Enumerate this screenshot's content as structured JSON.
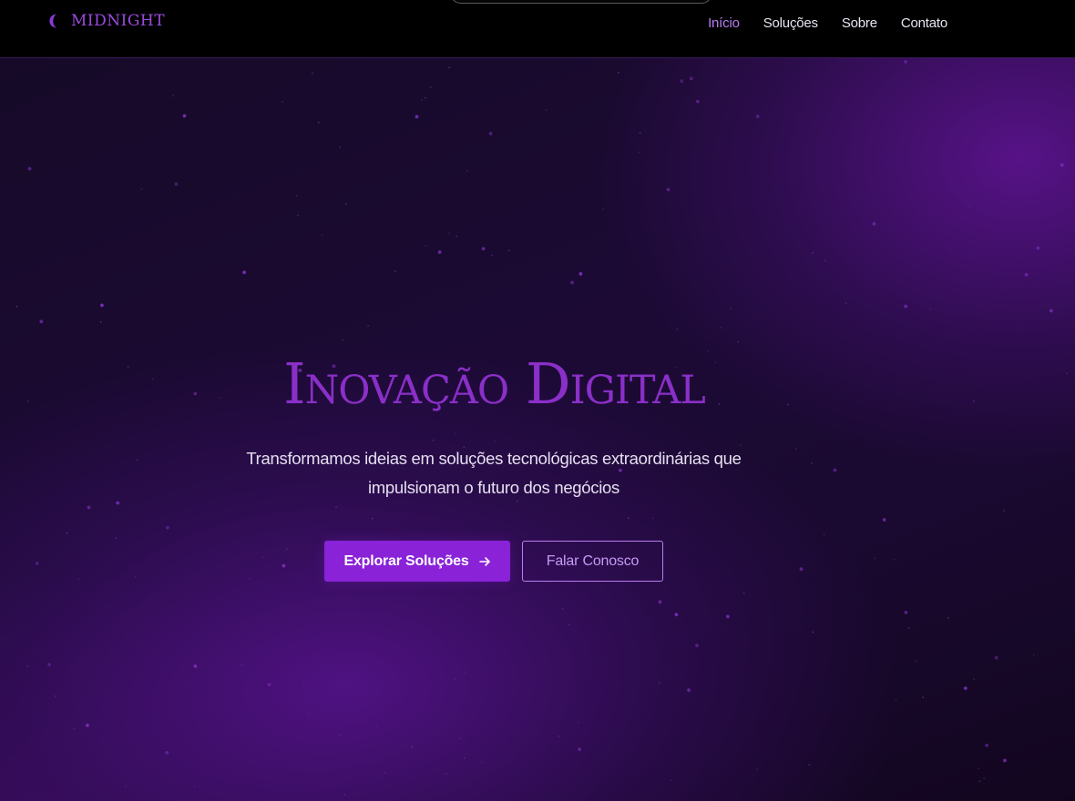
{
  "nav": {
    "brand": "MIDNIGHT",
    "links": [
      {
        "label": "Início",
        "active": true
      },
      {
        "label": "Soluções",
        "active": false
      },
      {
        "label": "Sobre",
        "active": false
      },
      {
        "label": "Contato",
        "active": false
      }
    ]
  },
  "hero": {
    "title": "Inovação Digital",
    "subtitle": "Transformamos ideias em soluções tecnológicas extraordinárias que impulsionam o futuro dos negócios",
    "primary_button": "Explorar Soluções",
    "secondary_button": "Falar Conosco"
  },
  "icons": {
    "brand": "moon-icon",
    "primary_button": "arrow-right-icon"
  },
  "colors": {
    "accent": "#8a22d8",
    "accent_light": "#b77ef2",
    "title": "#8a2fc8",
    "nav_background": "#000000",
    "hero_dark": "#160a28"
  }
}
